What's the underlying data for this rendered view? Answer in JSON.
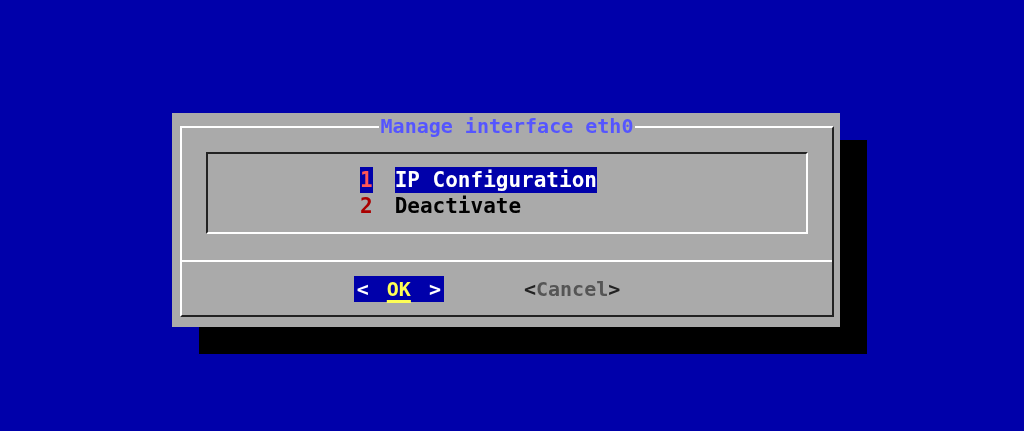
{
  "dialog": {
    "title": "Manage interface eth0",
    "menu": [
      {
        "tag": "1",
        "label": "IP Configuration",
        "selected": true
      },
      {
        "tag": "2",
        "label": "Deactivate",
        "selected": false
      }
    ],
    "buttons": [
      {
        "left": "<",
        "label": "OK",
        "right": ">",
        "selected": true
      },
      {
        "left": "<",
        "label": "Cancel",
        "right": ">",
        "selected": false
      }
    ]
  }
}
